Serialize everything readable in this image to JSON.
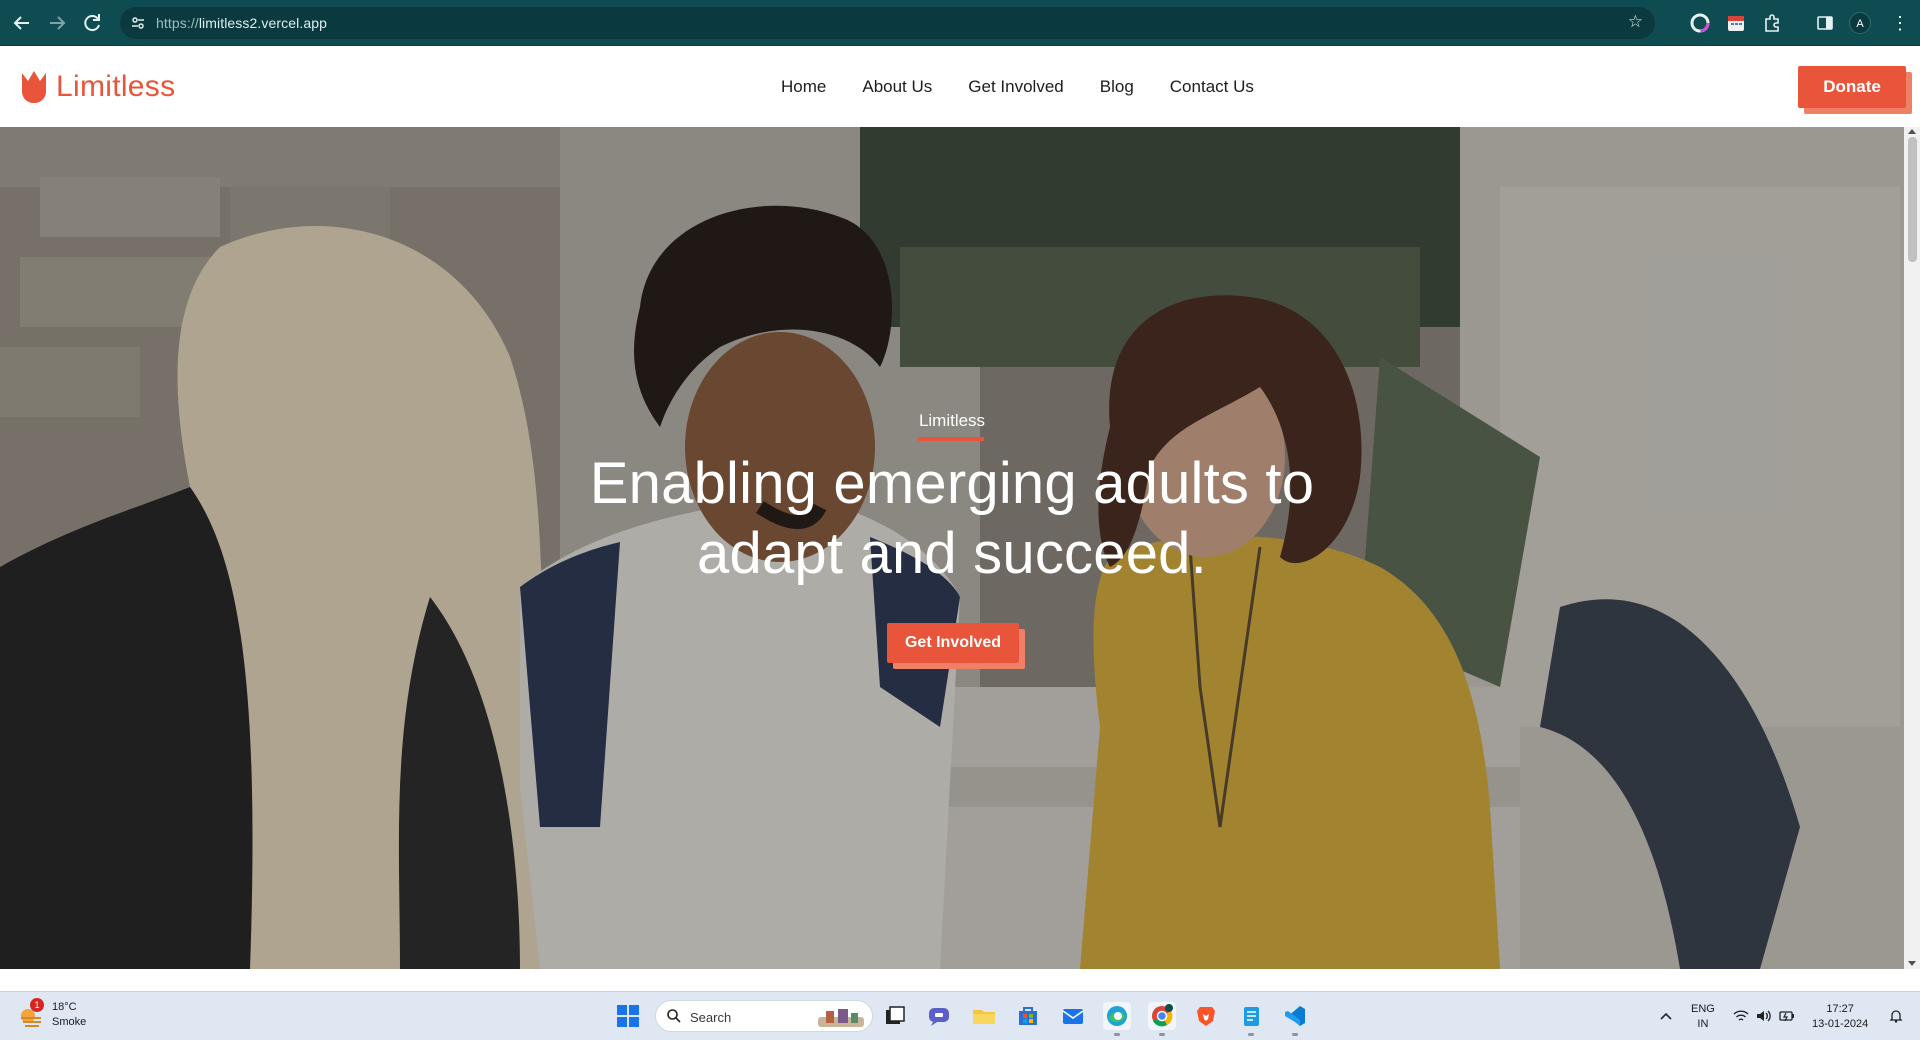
{
  "browser": {
    "url_scheme": "https://",
    "url_host": "limitless2.vercel.app",
    "profile_initial": "A",
    "icons": [
      "back-arrow-icon",
      "forward-arrow-icon",
      "reload-icon",
      "site-info-icon",
      "bookmark-star-icon",
      "extension-color-icon",
      "extension-calendar-icon",
      "extensions-puzzle-icon",
      "side-panel-icon",
      "kebab-menu-icon"
    ]
  },
  "site": {
    "brand": "Limitless",
    "brand_color": "#e8553b",
    "nav": [
      "Home",
      "About Us",
      "Get Involved",
      "Blog",
      "Contact Us"
    ],
    "donate_label": "Donate"
  },
  "hero": {
    "eyebrow": "Limitless",
    "title_line1": "Enabling emerging adults to",
    "title_line2": "adapt and succeed.",
    "cta_label": "Get Involved"
  },
  "taskbar": {
    "weather_temp": "18°C",
    "weather_desc": "Smoke",
    "weather_badge": "1",
    "search_label": "Search",
    "lang_line1": "ENG",
    "lang_line2": "IN",
    "time": "17:27",
    "date": "13-01-2024"
  }
}
